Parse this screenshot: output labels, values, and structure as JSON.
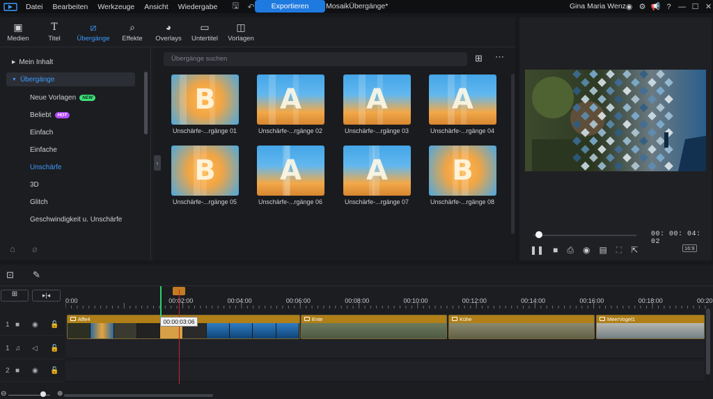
{
  "menu": {
    "items": [
      "Datei",
      "Bearbeiten",
      "Werkzeuge",
      "Ansicht",
      "Wiedergabe"
    ],
    "export_label": "Exportieren",
    "project_title": "MosaikÜbergänge*",
    "user_name": "Gina Maria Wenz"
  },
  "tabs": [
    {
      "label": "Medien",
      "icon": "media-icon"
    },
    {
      "label": "Titel",
      "icon": "title-icon"
    },
    {
      "label": "Übergänge",
      "icon": "transitions-icon"
    },
    {
      "label": "Effekte",
      "icon": "effects-icon"
    },
    {
      "label": "Overlays",
      "icon": "overlays-icon"
    },
    {
      "label": "Untertitel",
      "icon": "subtitles-icon"
    },
    {
      "label": "Vorlagen",
      "icon": "templates-icon"
    }
  ],
  "sidebar": {
    "my_content": "Mein Inhalt",
    "transitions": "Übergänge",
    "items": [
      {
        "label": "Neue Vorlagen",
        "badge": "NEW"
      },
      {
        "label": "Beliebt",
        "badge": "HOT"
      },
      {
        "label": "Einfach"
      },
      {
        "label": "Einfache"
      },
      {
        "label": "Unschärfe"
      },
      {
        "label": "3D"
      },
      {
        "label": "Glitch"
      },
      {
        "label": "Geschwindigkeit u. Unschärfe"
      }
    ],
    "badge_colors": {
      "NEW": "#3ee07a",
      "HOT": "#b44bff"
    }
  },
  "search": {
    "placeholder": "Übergänge suchen"
  },
  "transitions_grid": [
    {
      "label": "Unschärfe-...rgänge 01",
      "letter": "B"
    },
    {
      "label": "Unschärfe-...rgänge 02",
      "letter": "A"
    },
    {
      "label": "Unschärfe-...rgänge 03",
      "letter": "A"
    },
    {
      "label": "Unschärfe-...rgänge 04",
      "letter": "A"
    },
    {
      "label": "Unschärfe-...rgänge 05",
      "letter": "B"
    },
    {
      "label": "Unschärfe-...rgänge 06",
      "letter": "A"
    },
    {
      "label": "Unschärfe-...rgänge 07",
      "letter": "A"
    },
    {
      "label": "Unschärfe-...rgänge 08",
      "letter": "B"
    }
  ],
  "preview": {
    "time": "00: 00: 04: 02",
    "ratio": "16:9",
    "progress": 0.02
  },
  "timeline": {
    "ticks": [
      "0:00",
      "00:02:00",
      "00:04:00",
      "00:06:00",
      "00:08:00",
      "00:10:00",
      "00:12:00",
      "00:14:00",
      "00:16:00",
      "00:18:00",
      "00:20:00"
    ],
    "tooltip": "00:00:03:06",
    "tracks": [
      {
        "number": "1"
      },
      {
        "number": "1"
      },
      {
        "number": "2"
      }
    ],
    "clips": [
      "Affe4",
      "Ente",
      "Kühe",
      "MeerVogel1"
    ]
  },
  "colors": {
    "accent": "#3d9bff",
    "export": "#1f7ae0",
    "clip_header": "#b07f17",
    "playhead": "#c0282a"
  }
}
